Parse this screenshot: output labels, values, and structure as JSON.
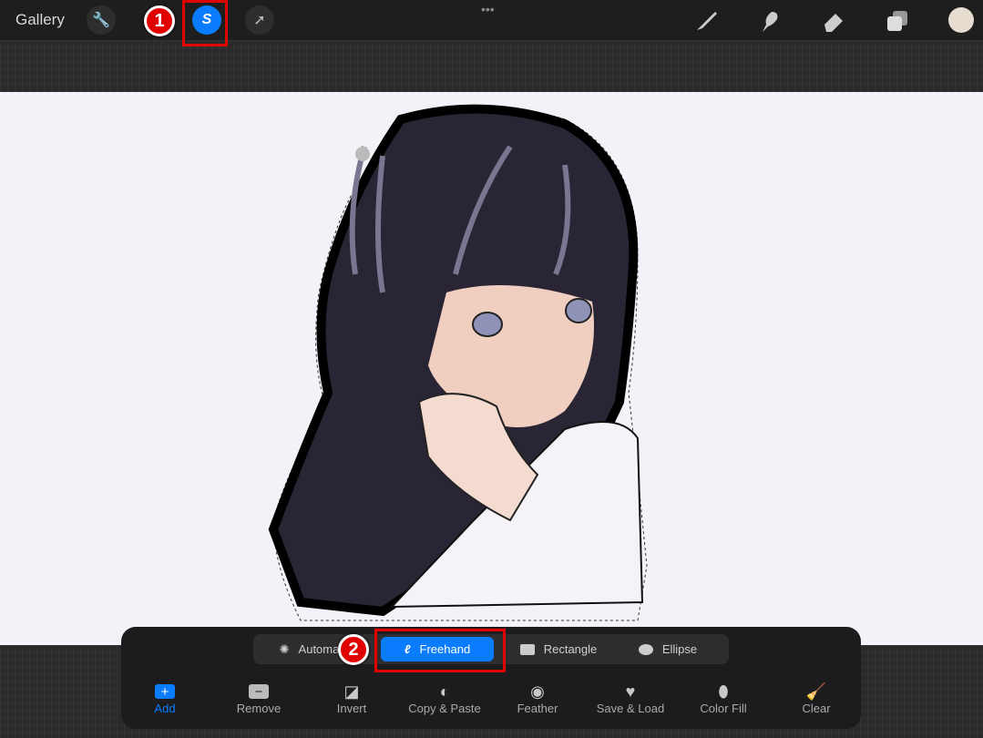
{
  "topbar": {
    "gallery": "Gallery",
    "icons": [
      "wrench-icon",
      "selection-icon",
      "transform-arrow-icon",
      "brush-icon",
      "smudge-icon",
      "eraser-icon",
      "layers-icon",
      "color-swatch"
    ],
    "more": "•••",
    "accent": "#0a7cff",
    "color_swatch": "#e6dccf"
  },
  "selection_modes": [
    {
      "label": "Automatic",
      "icon": "automatic-icon"
    },
    {
      "label": "Freehand",
      "icon": "freehand-icon",
      "active": true
    },
    {
      "label": "Rectangle",
      "icon": "rectangle-icon"
    },
    {
      "label": "Ellipse",
      "icon": "ellipse-icon"
    }
  ],
  "actions": [
    {
      "label": "Add"
    },
    {
      "label": "Remove"
    },
    {
      "label": "Invert"
    },
    {
      "label": "Copy & Paste"
    },
    {
      "label": "Feather"
    },
    {
      "label": "Save & Load"
    },
    {
      "label": "Color Fill"
    },
    {
      "label": "Clear"
    }
  ],
  "annotations": {
    "step1": "1",
    "step2": "2",
    "color": "#e00000"
  }
}
